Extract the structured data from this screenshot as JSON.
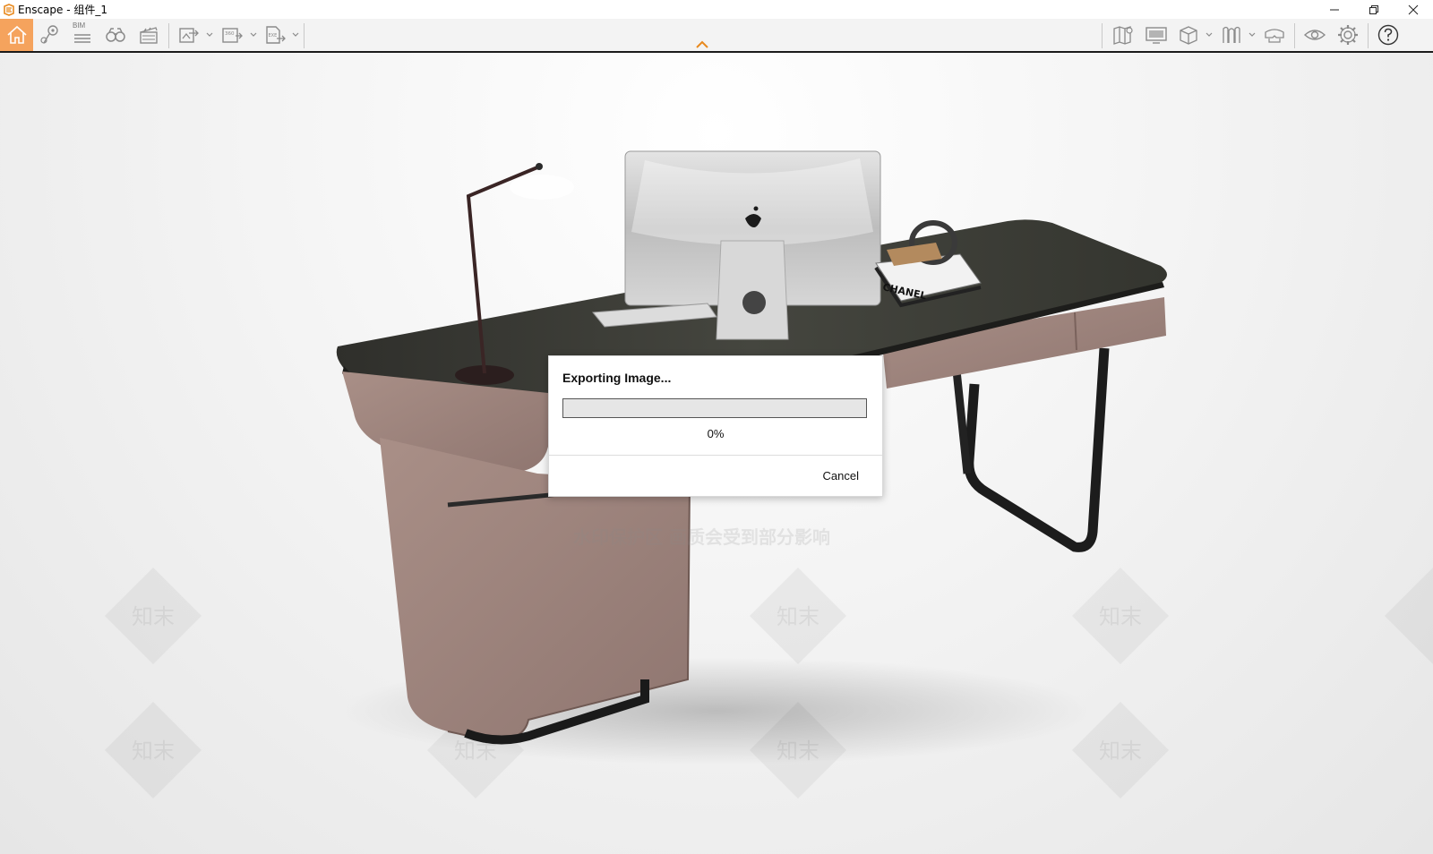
{
  "window": {
    "title": "Enscape - 组件_1",
    "controls": [
      "minimize",
      "restore",
      "close"
    ]
  },
  "toolbar": {
    "accent_color": "#f5a35d",
    "left_buttons": [
      {
        "name": "home-icon",
        "active": true
      },
      {
        "name": "map-pin-icon"
      },
      {
        "name": "bim-icon",
        "label": "BIM"
      },
      {
        "name": "binoculars-icon"
      },
      {
        "name": "clapperboard-icon"
      },
      {
        "name": "export-image-icon",
        "dropdown": true
      },
      {
        "name": "export-360-icon",
        "label": "360",
        "dropdown": true
      },
      {
        "name": "export-exe-icon",
        "label": "EXE",
        "dropdown": true
      }
    ],
    "right_buttons": [
      {
        "name": "map-icon"
      },
      {
        "name": "monitor-icon"
      },
      {
        "name": "cube-icon",
        "dropdown": true
      },
      {
        "name": "asset-library-icon",
        "dropdown": true
      },
      {
        "name": "vr-headset-icon"
      },
      {
        "name": "eye-icon"
      },
      {
        "name": "settings-gear-icon"
      },
      {
        "name": "help-icon"
      }
    ],
    "bim_label": "BIM",
    "label_360": "360",
    "label_exe": "EXE"
  },
  "dialog": {
    "title": "Exporting Image...",
    "progress_fraction": 0,
    "progress_text": "0%",
    "cancel_label": "Cancel"
  },
  "viewport": {
    "watermark_text": "水印保护区  画质会受到部分影响",
    "tile_text": "知末",
    "book_text": "CHANEL"
  }
}
